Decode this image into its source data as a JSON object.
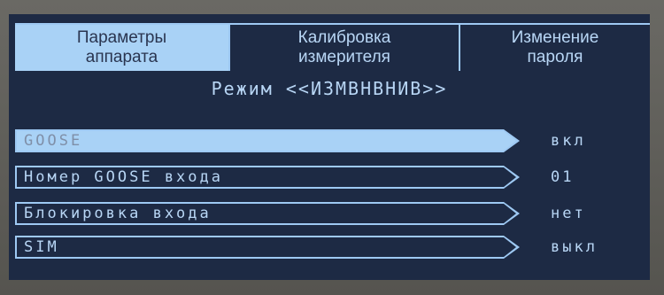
{
  "tabs": [
    {
      "label": "Параметры\nаппарата",
      "active": true
    },
    {
      "label": "Калибровка\nизмерителя",
      "active": false
    },
    {
      "label": "Изменение\nпароля",
      "active": false
    }
  ],
  "mode_title": "Режим <<ИЗМВНВНИВ>>",
  "settings": [
    {
      "label": "GOOSE",
      "value": "вкл",
      "selected": true
    },
    {
      "label": "Номер GOOSE входа",
      "value": "01",
      "selected": false
    },
    {
      "label": "Блокировка входа",
      "value": "нет",
      "selected": false
    },
    {
      "label": "SIM",
      "value": "выкл",
      "selected": false
    }
  ],
  "colors": {
    "screen_bg": "#1d2a44",
    "accent": "#a9d2f6",
    "text": "#b8d6f5"
  }
}
